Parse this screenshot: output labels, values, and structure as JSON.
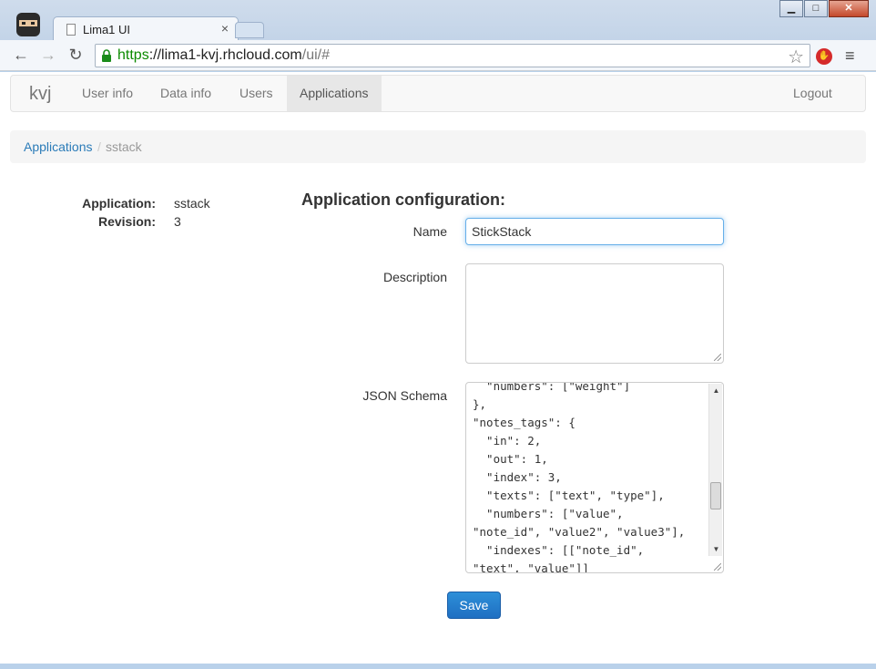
{
  "browser": {
    "tab_title": "Lima1 UI",
    "url_scheme": "https",
    "url_sep": "://",
    "url_host": "lima1-kvj.rhcloud.com",
    "url_path": "/ui/#"
  },
  "navbar": {
    "brand": "kvj",
    "items": [
      "User info",
      "Data info",
      "Users",
      "Applications"
    ],
    "active_item": "Applications",
    "logout": "Logout"
  },
  "breadcrumb": {
    "parent": "Applications",
    "separator": "/",
    "current": "sstack"
  },
  "info": {
    "application_label": "Application:",
    "application_value": "sstack",
    "revision_label": "Revision:",
    "revision_value": "3"
  },
  "form": {
    "title": "Application configuration:",
    "name_label": "Name",
    "name_value": "StickStack",
    "description_label": "Description",
    "description_value": "",
    "schema_label": "JSON Schema",
    "schema_lines": [
      "  \"numbers\": [\"weight\"]",
      "},",
      "\"notes_tags\": {",
      "  \"in\": 2,",
      "  \"out\": 1,",
      "  \"index\": 3,",
      "  \"texts\": [\"text\", \"type\"],",
      "  \"numbers\": [\"value\",",
      "\"note_id\", \"value2\", \"value3\"],",
      "  \"indexes\": [[\"note_id\",",
      "\"text\", \"value\"]]"
    ],
    "save_label": "Save"
  },
  "icons": [
    "back-icon",
    "forward-icon",
    "reload-icon",
    "lock-icon",
    "star-icon",
    "adblock-icon",
    "menu-icon",
    "document-icon",
    "close-icon"
  ]
}
